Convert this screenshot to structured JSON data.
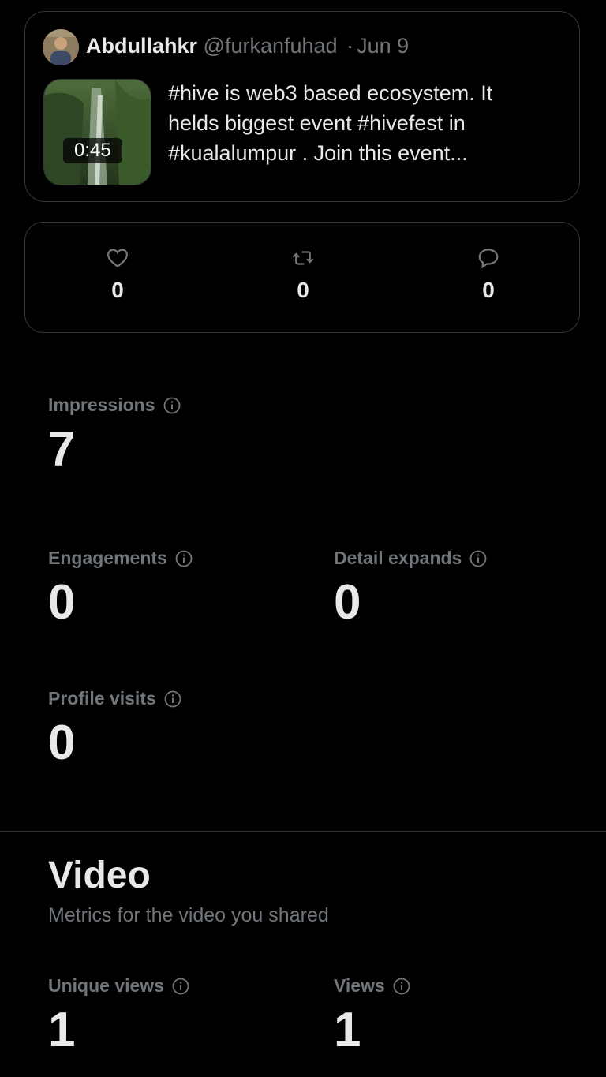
{
  "tweet": {
    "author": "Abdullahkr",
    "handle": "@furkanfuhad",
    "separator": "·",
    "date": "Jun 9",
    "duration": "0:45",
    "text": "#hive is web3 based ecosystem. It helds biggest event #hivefest in #kualalumpur  . Join this event..."
  },
  "engagement": {
    "likes": "0",
    "retweets": "0",
    "replies": "0"
  },
  "metrics": {
    "impressions": {
      "label": "Impressions",
      "value": "7"
    },
    "engagements": {
      "label": "Engagements",
      "value": "0"
    },
    "detail_expands": {
      "label": "Detail expands",
      "value": "0"
    },
    "profile_visits": {
      "label": "Profile visits",
      "value": "0"
    }
  },
  "video": {
    "title": "Video",
    "subtitle": "Metrics for the video you shared",
    "unique_views": {
      "label": "Unique views",
      "value": "1"
    },
    "views": {
      "label": "Views",
      "value": "1"
    }
  },
  "icons": {
    "like": "heart-icon",
    "retweet": "retweet-icon",
    "reply": "reply-icon",
    "info": "info-icon"
  },
  "colors": {
    "background": "#000000",
    "text": "#e7e9ea",
    "muted": "#71767b",
    "border": "#333639"
  }
}
